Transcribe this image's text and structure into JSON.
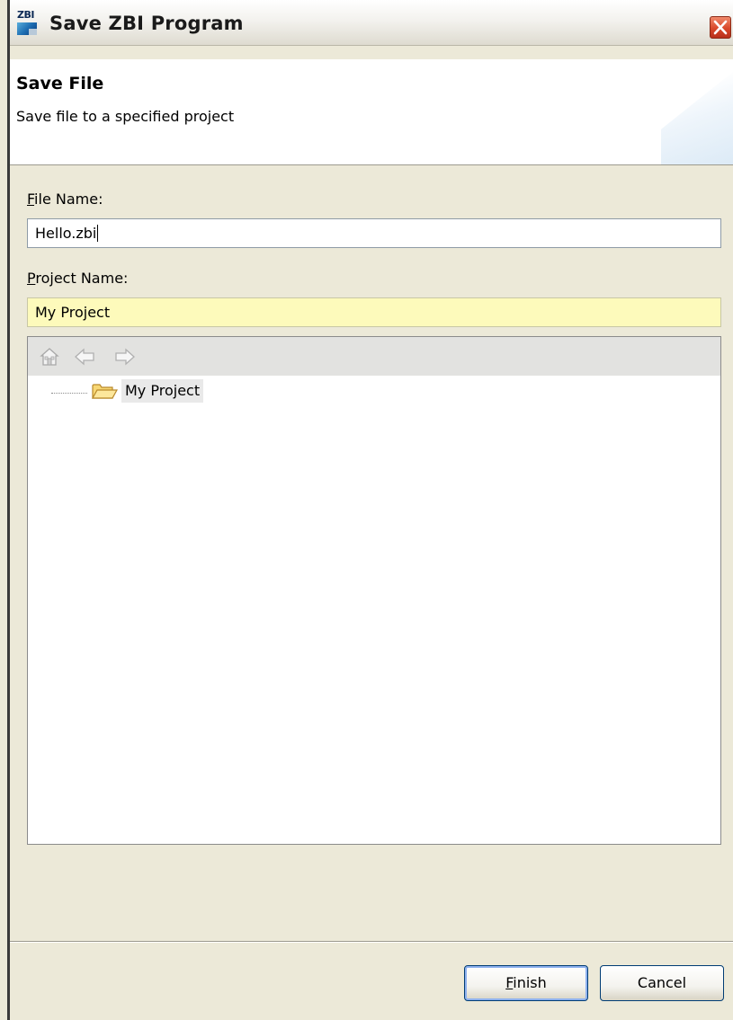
{
  "window": {
    "title": "Save ZBI Program",
    "app_icon_label": "ZBI"
  },
  "header": {
    "title": "Save File",
    "description": "Save file to a specified project"
  },
  "form": {
    "file_name_label_mnemonic": "F",
    "file_name_label_rest": "ile Name:",
    "file_name_value": "Hello.zbi",
    "project_name_label_mnemonic": "P",
    "project_name_label_rest": "roject Name:",
    "project_name_value": "My Project"
  },
  "tree": {
    "toolbar_icons": [
      "home-icon",
      "back-arrow-icon",
      "forward-arrow-icon"
    ],
    "items": [
      {
        "label": "My Project",
        "icon": "open-folder-icon"
      }
    ]
  },
  "buttons": {
    "finish_mnemonic": "F",
    "finish_rest": "inish",
    "cancel": "Cancel"
  }
}
